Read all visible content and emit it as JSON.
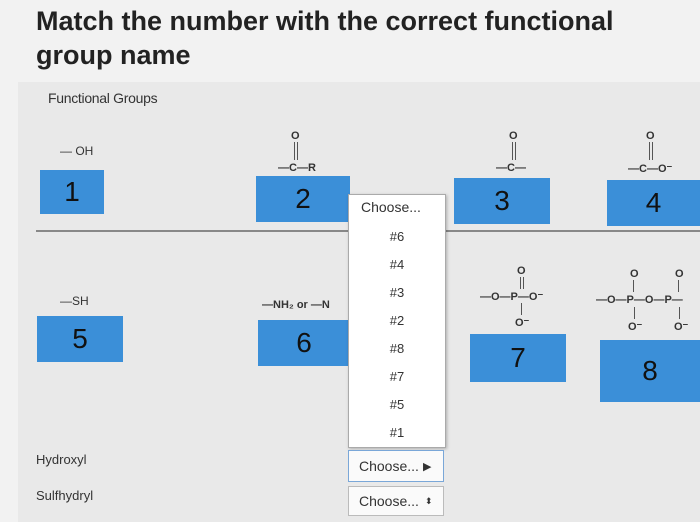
{
  "title": "Match the number with the correct functional group name",
  "panel": {
    "header": "Functional Groups"
  },
  "structures": {
    "hydroxyl": "— OH",
    "carbonyl_o": "O",
    "carbonyl_chain": "—C—R",
    "carboxyl_o": "O",
    "carboxyl_chain": "—C—",
    "carboxylate_o": "O",
    "carboxylate_chain": "—C—O⁻",
    "sulfhydryl": "—SH",
    "amino": "—NH₂ or —N",
    "phosphate_chain": "—O—P—O⁻",
    "phosphate_o_top": "O",
    "phosphate_o_bottom": "O⁻",
    "diphosphate_chain": "—O—P—O—P—",
    "diphosphate_o_top1": "O",
    "diphosphate_o_top2": "O",
    "diphosphate_o_bottom1": "O⁻",
    "diphosphate_o_bottom2": "O⁻"
  },
  "boxes": [
    "1",
    "2",
    "3",
    "4",
    "5",
    "6",
    "7",
    "8"
  ],
  "dropdown": {
    "placeholder": "Choose...",
    "options": [
      "#6",
      "#4",
      "#3",
      "#2",
      "#8",
      "#7",
      "#5",
      "#1"
    ]
  },
  "rows": [
    {
      "label": "Hydroxyl",
      "select": "Choose..."
    },
    {
      "label": "Sulfhydryl",
      "select": "Choose..."
    }
  ]
}
